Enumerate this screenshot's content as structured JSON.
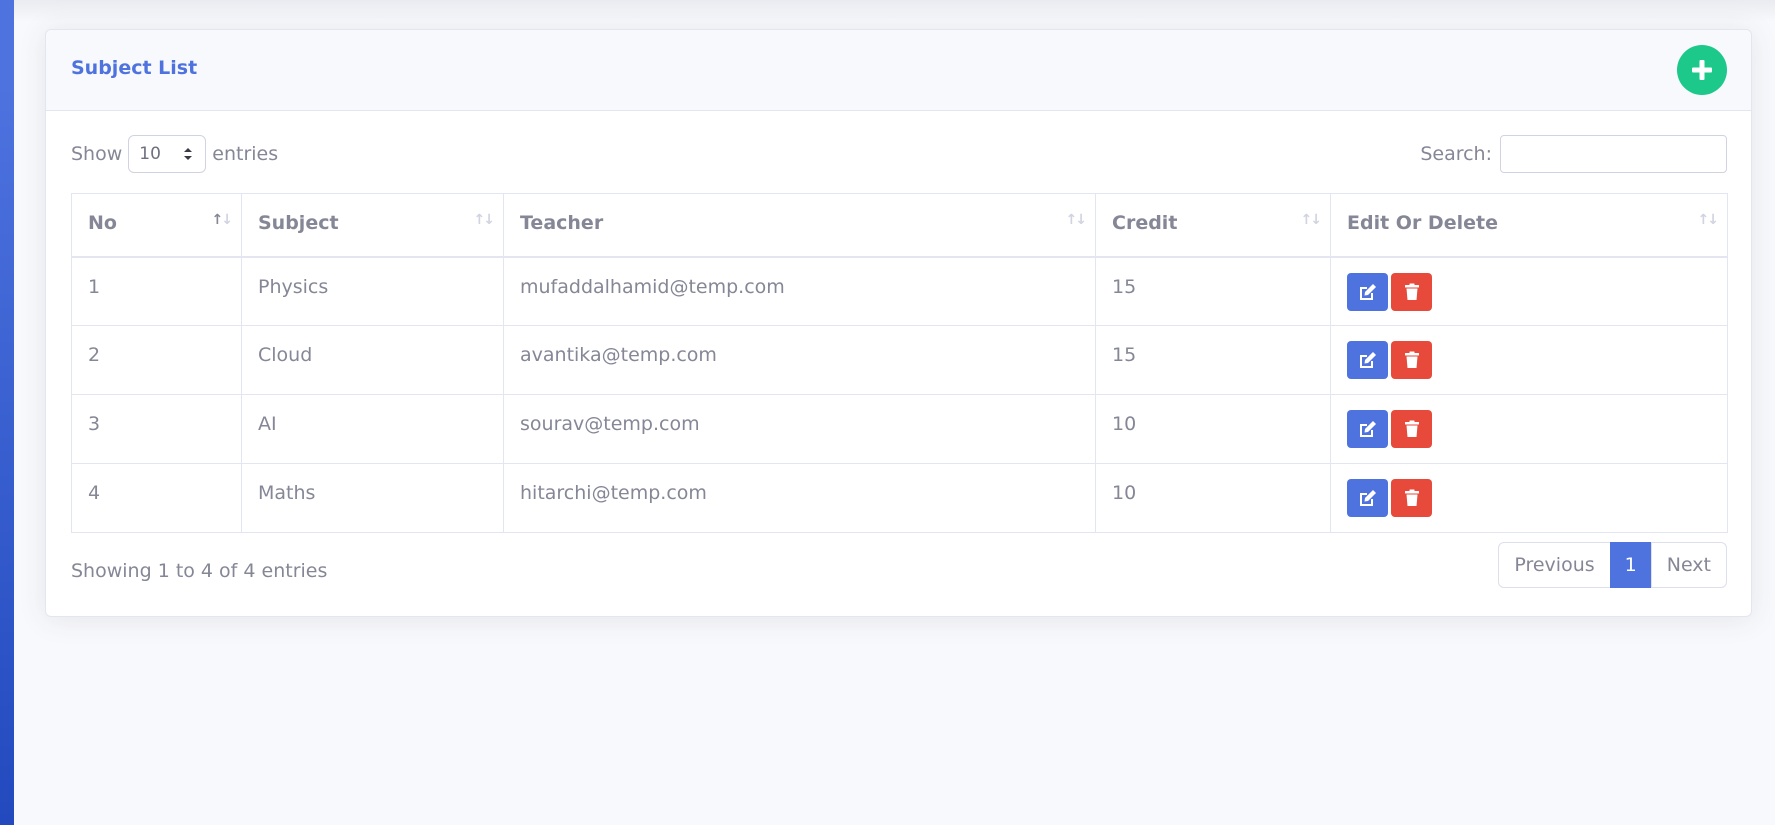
{
  "card": {
    "title": "Subject List",
    "add_icon": "plus-circle-icon"
  },
  "length": {
    "show_label": "Show",
    "selected": "10",
    "entries_label": "entries"
  },
  "search": {
    "label": "Search:",
    "value": "",
    "placeholder": ""
  },
  "table": {
    "columns": [
      "No",
      "Subject",
      "Teacher",
      "Credit",
      "Edit Or Delete"
    ],
    "rows": [
      {
        "no": "1",
        "subject": "Physics",
        "teacher": "mufaddalhamid@temp.com",
        "credit": "15"
      },
      {
        "no": "2",
        "subject": "Cloud",
        "teacher": "avantika@temp.com",
        "credit": "15"
      },
      {
        "no": "3",
        "subject": "AI",
        "teacher": "sourav@temp.com",
        "credit": "10"
      },
      {
        "no": "4",
        "subject": "Maths",
        "teacher": "hitarchi@temp.com",
        "credit": "10"
      }
    ],
    "edit_icon": "edit-icon",
    "delete_icon": "trash-icon"
  },
  "footer": {
    "info": "Showing 1 to 4 of 4 entries",
    "previous": "Previous",
    "current_page": "1",
    "next": "Next"
  },
  "colors": {
    "primary": "#4e73df",
    "success": "#1cc88a",
    "danger": "#e74a3b",
    "text": "#858796"
  }
}
